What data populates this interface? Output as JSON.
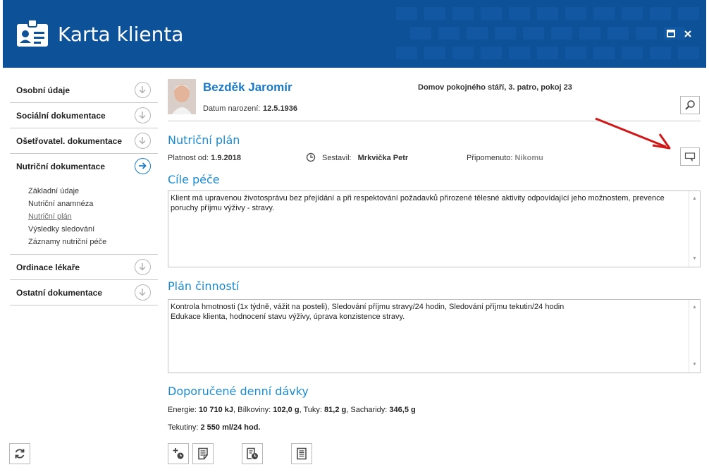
{
  "window": {
    "title": "Karta klienta",
    "header_color": "#0d5199",
    "accent": "#1a7ac8"
  },
  "sidebar": {
    "items": [
      {
        "label": "Osobní údaje"
      },
      {
        "label": "Sociální dokumentace"
      },
      {
        "label": "Ošetřovatel. dokumentace"
      },
      {
        "label": "Nutriční dokumentace"
      },
      {
        "label": "Ordinace lékaře"
      },
      {
        "label": "Ostatní dokumentace"
      }
    ],
    "subitems": [
      {
        "label": "Základní údaje"
      },
      {
        "label": "Nutriční anamnéza"
      },
      {
        "label": "Nutriční plán"
      },
      {
        "label": "Výsledky sledování"
      },
      {
        "label": "Záznamy nutriční péče"
      }
    ]
  },
  "client": {
    "name": "Bezděk Jaromír",
    "birth_label": "Datum narození:",
    "birth_value": "12.5.1936",
    "location": "Domov pokojného stáří, 3. patro, pokoj 23"
  },
  "plan": {
    "title": "Nutriční plán",
    "validity_label": "Platnost od:",
    "validity_value": "1.9.2018",
    "author_label": "Sestavil:",
    "author_value": "Mrkvička Petr",
    "comment_label": "Připomenuto:",
    "comment_value": "Nikomu"
  },
  "goals": {
    "title": "Cíle péče",
    "text": "Klient má upravenou životosprávu bez přejídání a při respektování požadavků přirozené tělesné aktivity odpovídající jeho možnostem, prevence poruchy příjmu výživy - stravy."
  },
  "activities": {
    "title": "Plán činností",
    "line1": "Kontrola hmotnosti (1x týdně, vážit na posteli), Sledování příjmu stravy/24 hodin, Sledování příjmu tekutin/24 hodin",
    "line2": "Edukace klienta, hodnocení stavu výživy, úprava konzistence stravy."
  },
  "doses": {
    "title": "Doporučené denní dávky",
    "energy_label": "Energie:",
    "energy_value": "10 710 kJ",
    "protein_label": "Bílkoviny:",
    "protein_value": "102,0 g",
    "fat_label": "Tuky:",
    "fat_value": "81,2 g",
    "carb_label": "Sacharidy:",
    "carb_value": "346,5 g",
    "fluid_label": "Tekutiny:",
    "fluid_value": "2 550 ml/24 hod."
  },
  "icons": {
    "search": "magnifier-icon",
    "comment": "speech-bubble-icon",
    "refresh": "refresh-icon",
    "add_time": "add-time-icon",
    "note": "note-icon",
    "schedule": "schedule-icon",
    "document": "document-icon"
  }
}
